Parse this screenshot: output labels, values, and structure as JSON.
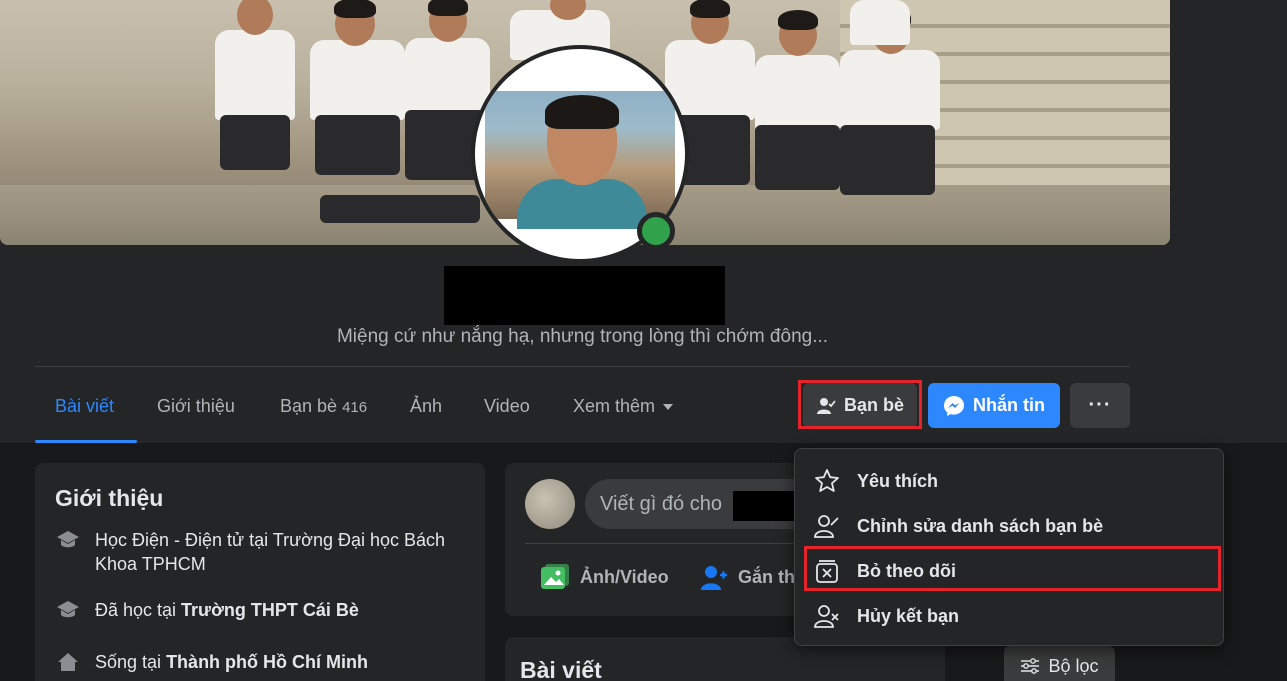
{
  "profile": {
    "bio": "Miệng cứ như nắng hạ, nhưng trong lòng thì chớm đông..."
  },
  "tabs": [
    {
      "label": "Bài viết"
    },
    {
      "label": "Giới thiệu"
    },
    {
      "label": "Bạn bè",
      "count": "416"
    },
    {
      "label": "Ảnh"
    },
    {
      "label": "Video"
    },
    {
      "label": "Xem thêm"
    }
  ],
  "actions": {
    "friends_label": "Bạn bè",
    "message_label": "Nhắn tin",
    "more_label": "···"
  },
  "intro": {
    "title": "Giới thiệu",
    "rows": [
      {
        "text": "Học Điện - Điện tử tại Trường Đại học Bách Khoa TPHCM"
      },
      {
        "prefix": "Đã học tại ",
        "bold": "Trường THPT Cái Bè"
      },
      {
        "prefix": "Sống tại ",
        "bold": "Thành phố Hồ Chí Minh"
      }
    ]
  },
  "composer": {
    "placeholder": "Viết gì đó cho",
    "photo_video_label": "Ảnh/Video",
    "tag_label": "Gắn th"
  },
  "posts": {
    "title": "Bài viết",
    "filter_label": "Bộ lọc"
  },
  "dropdown": {
    "items": [
      {
        "label": "Yêu thích",
        "icon": "star-icon"
      },
      {
        "label": "Chỉnh sửa danh sách bạn bè",
        "icon": "edit-friend-list-icon"
      },
      {
        "label": "Bỏ theo dõi",
        "icon": "unfollow-icon"
      },
      {
        "label": "Hủy kết bạn",
        "icon": "unfriend-icon"
      }
    ]
  },
  "colors": {
    "accent": "#2d88ff",
    "highlight": "#e4232b",
    "online": "#31a24c"
  }
}
